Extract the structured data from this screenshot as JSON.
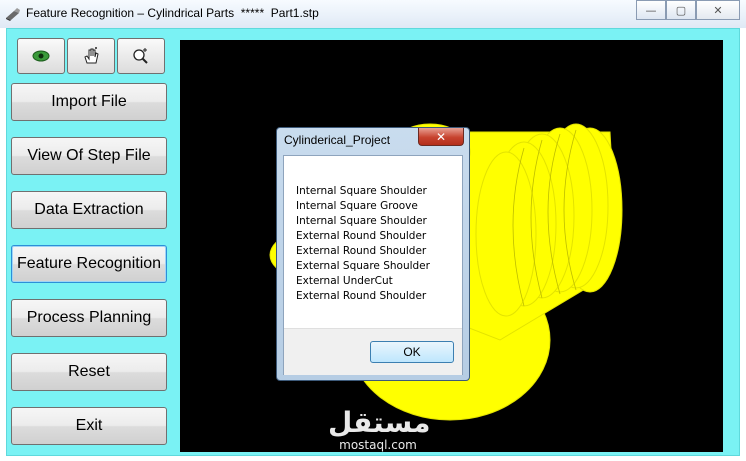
{
  "window": {
    "title": "Feature Recognition – Cylindrical Parts  *****  Part1.stp",
    "minimize_glyph": "—",
    "maximize_glyph": "▢",
    "close_glyph": "✕"
  },
  "toolbar": {
    "icons": [
      "eye-icon",
      "hand-pan-icon",
      "zoom-icon"
    ]
  },
  "nav": {
    "buttons": [
      "Import File",
      "View Of Step File",
      "Data Extraction",
      "Feature Recognition",
      "Process Planning",
      "Reset",
      "Exit"
    ],
    "focused": "Feature Recognition"
  },
  "viewport": {
    "background": "#000000",
    "part_color": "#ffff00"
  },
  "dialog": {
    "title": "Cylinderical_Project",
    "close_glyph": "✕",
    "lines": [
      "Internal Square Shoulder",
      "Internal Square Groove",
      "Internal Square Shoulder",
      "External Round Shoulder",
      "External Round Shoulder",
      "External Square Shoulder",
      "External UnderCut",
      "External Round Shoulder"
    ],
    "ok_label": "OK"
  },
  "watermark": {
    "arabic": "مستقل",
    "latin": "mostaql.com"
  },
  "colors": {
    "client_background": "#7af2f4"
  }
}
